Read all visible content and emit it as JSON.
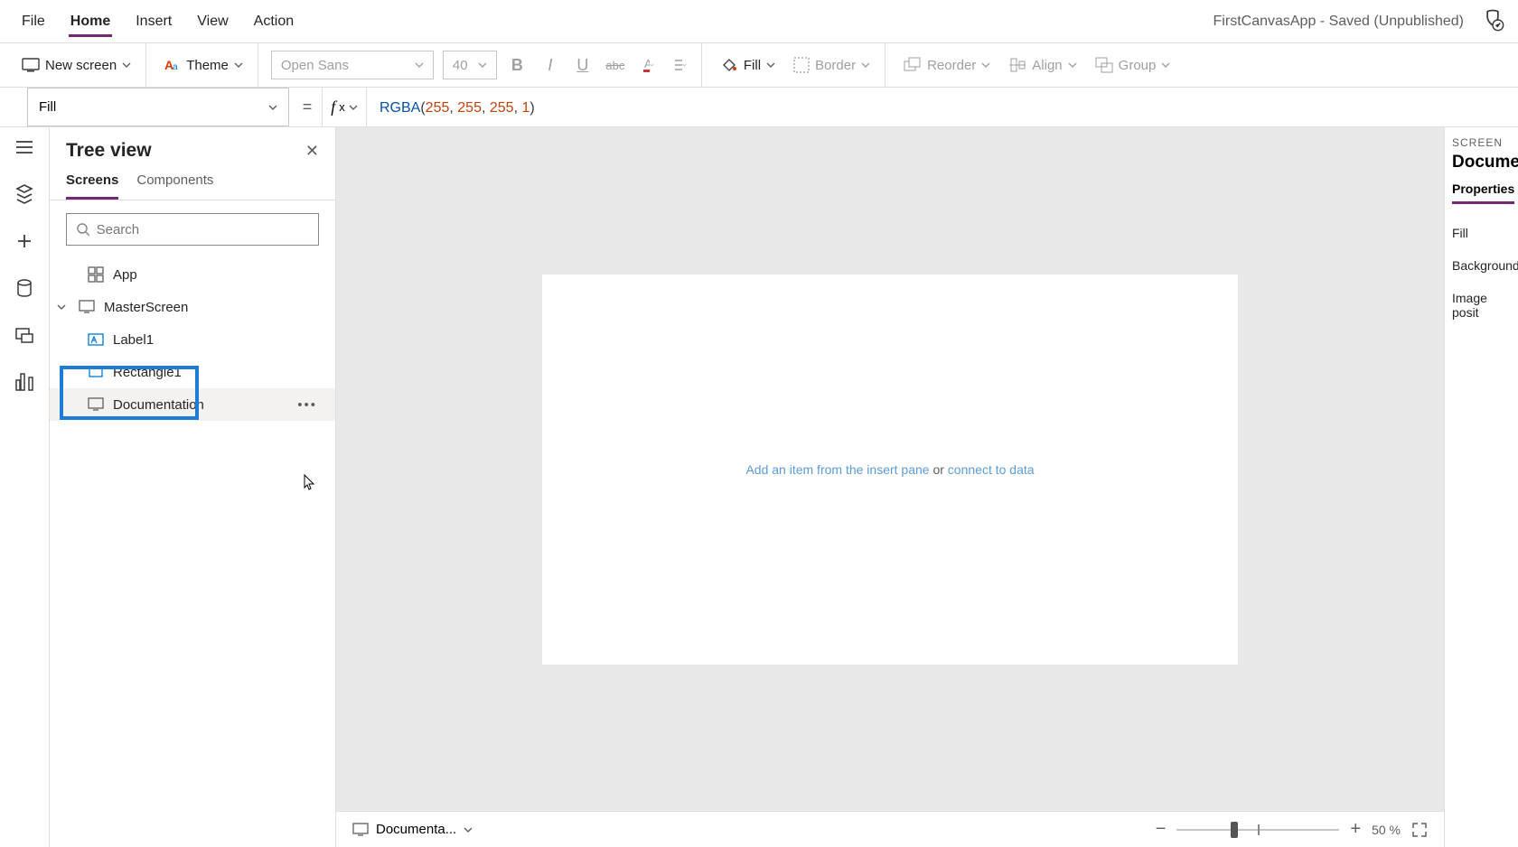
{
  "menu": {
    "tabs": [
      "File",
      "Home",
      "Insert",
      "View",
      "Action"
    ],
    "active": 1,
    "title": "FirstCanvasApp - Saved (Unpublished)"
  },
  "ribbon": {
    "newScreen": "New screen",
    "theme": "Theme",
    "font": "Open Sans",
    "fontSize": "40",
    "fill": "Fill",
    "border": "Border",
    "reorder": "Reorder",
    "align": "Align",
    "group": "Group"
  },
  "formulaBar": {
    "property": "Fill",
    "fn": "RGBA",
    "args": [
      "255",
      "255",
      "255",
      "1"
    ]
  },
  "treeView": {
    "title": "Tree view",
    "tabs": [
      "Screens",
      "Components"
    ],
    "activeTab": 0,
    "searchPlaceholder": "Search",
    "items": {
      "app": "App",
      "master": "MasterScreen",
      "label": "Label1",
      "rect": "Rectangle1",
      "doc": "Documentation"
    }
  },
  "canvas": {
    "placeholderA": "Add an item from the insert pane",
    "placeholderOr": " or ",
    "placeholderB": "connect to data"
  },
  "status": {
    "selected": "Documenta...",
    "zoom": "50",
    "zoomUnit": "%"
  },
  "propPane": {
    "category": "SCREEN",
    "name": "Document",
    "tab": "Properties",
    "rows": [
      "Fill",
      "Background",
      "Image posit"
    ]
  }
}
